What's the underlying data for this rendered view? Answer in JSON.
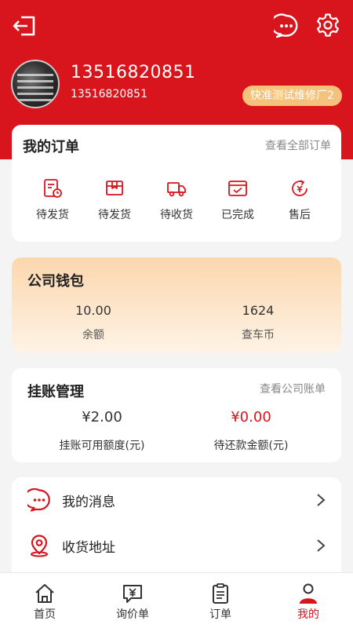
{
  "colors": {
    "brand": "#d8141c",
    "badge": "#f5c27c",
    "debt": "#d8141c"
  },
  "header": {
    "logout_icon": "logout-icon",
    "message_icon": "message-icon",
    "settings_icon": "gear-icon"
  },
  "profile": {
    "phone_main": "13516820851",
    "phone_sub": "13516820851",
    "shop_name": "快准测试维修厂2"
  },
  "orders": {
    "title": "我的订单",
    "view_all": "查看全部订单",
    "items": [
      {
        "label": "待发货",
        "icon": "order-pending-icon"
      },
      {
        "label": "待发货",
        "icon": "package-icon"
      },
      {
        "label": "待收货",
        "icon": "truck-icon"
      },
      {
        "label": "已完成",
        "icon": "completed-icon"
      },
      {
        "label": "售后",
        "icon": "after-sales-icon"
      }
    ]
  },
  "wallet": {
    "title": "公司钱包",
    "balance_value": "10.00",
    "balance_label": "余额",
    "coin_value": "1624",
    "coin_label": "查车币"
  },
  "credit": {
    "title": "挂账管理",
    "view_link": "查看公司账单",
    "available_value": "¥2.00",
    "available_label": "挂账可用额度(元)",
    "due_value": "¥0.00",
    "due_label": "待还款金额(元)"
  },
  "menu": [
    {
      "label": "我的消息",
      "icon": "chat-icon"
    },
    {
      "label": "收货地址",
      "icon": "location-icon"
    }
  ],
  "tabs": [
    {
      "label": "首页",
      "icon": "home-icon"
    },
    {
      "label": "询价单",
      "icon": "inquiry-icon"
    },
    {
      "label": "订单",
      "icon": "order-list-icon"
    },
    {
      "label": "我的",
      "icon": "user-icon",
      "active": true
    }
  ]
}
